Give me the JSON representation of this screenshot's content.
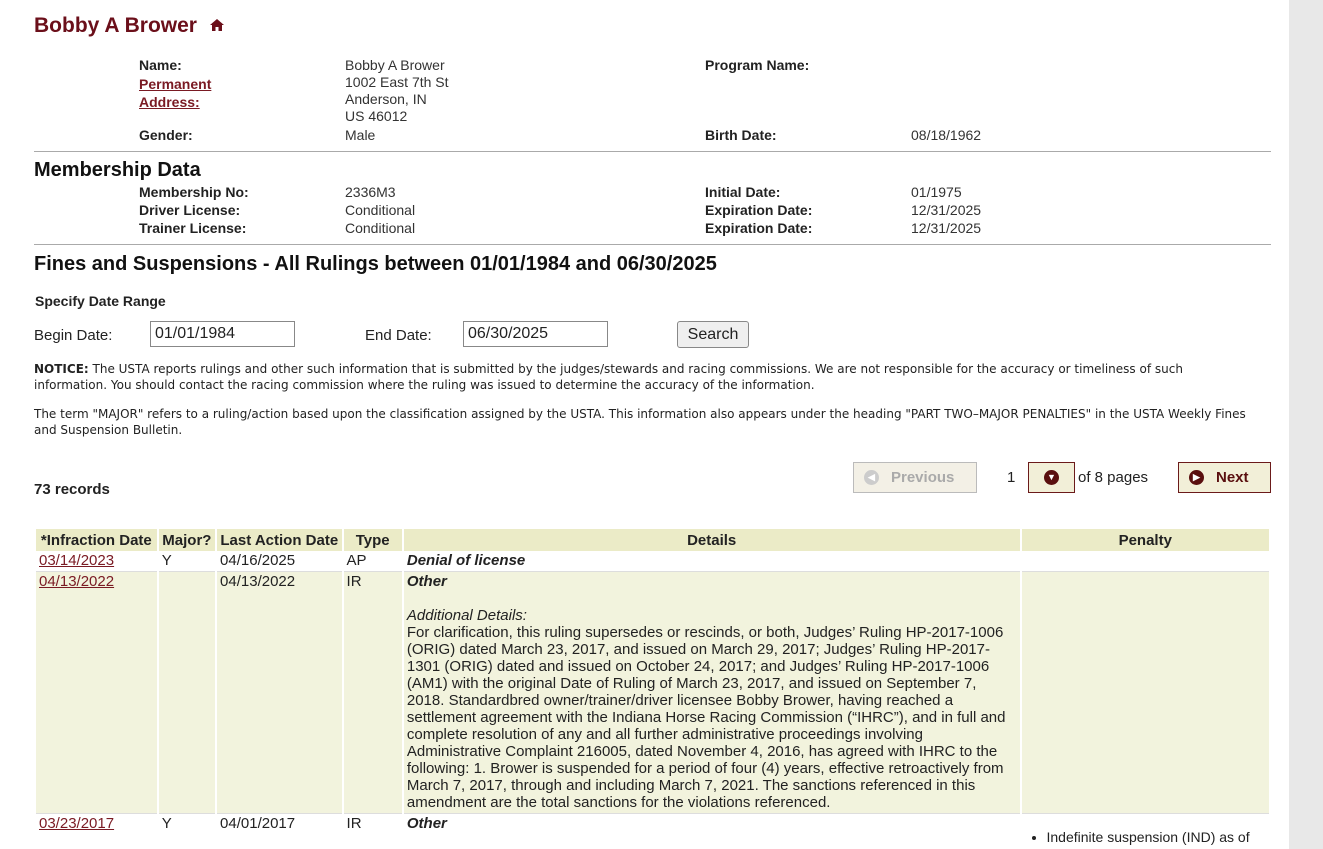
{
  "person": {
    "title": "Bobby A Brower",
    "name_label": "Name:",
    "name": "Bobby A Brower",
    "address_label_1": "Permanent",
    "address_label_2": "Address:",
    "address_line1": "1002 East 7th St",
    "address_line2": "Anderson, IN",
    "address_line3": "US 46012",
    "gender_label": "Gender:",
    "gender": "Male",
    "program_label": "Program Name:",
    "birth_label": "Birth Date:",
    "birth_date": "08/18/1962"
  },
  "membership": {
    "heading": "Membership Data",
    "no_label": "Membership No:",
    "no": "2336M3",
    "driver_label": "Driver License:",
    "driver": "Conditional",
    "trainer_label": "Trainer License:",
    "trainer": "Conditional",
    "initial_label": "Initial Date:",
    "initial": "01/1975",
    "exp_label": "Expiration Date:",
    "driver_exp": "12/31/2025",
    "trainer_exp": "12/31/2025"
  },
  "fines": {
    "heading": "Fines and Suspensions - All Rulings between 01/01/1984 and 06/30/2025",
    "range_label": "Specify Date Range",
    "begin_label": "Begin Date:",
    "begin_value": "01/01/1984",
    "end_label": "End Date:",
    "end_value": "06/30/2025",
    "search_label": "Search",
    "notice_bold": "NOTICE:",
    "notice_text": " The USTA reports rulings and other such information that is submitted by the judges/stewards and racing commissions. We are not responsible for the accuracy or timeliness of such information. You should contact the racing commission where the ruling was issued to determine the accuracy of the information.",
    "major_text": "The term \"MAJOR\" refers to a ruling/action based upon the classification assigned by the USTA. This information also appears under the heading \"PART TWO–MAJOR PENALTIES\" in the USTA Weekly Fines and Suspension Bulletin.",
    "records": "73 records"
  },
  "pagination": {
    "previous": "Previous",
    "current_page": "1",
    "of_pages": "of 8 pages",
    "next": "Next"
  },
  "table": {
    "headers": [
      "*Infraction Date",
      "Major?",
      "Last Action Date",
      "Type",
      "Details",
      "Penalty"
    ],
    "rows": [
      {
        "date": "03/14/2023",
        "major": "Y",
        "last": "04/16/2025",
        "type": "AP",
        "details": "Denial of license",
        "additional_label": "",
        "additional": "",
        "penalty": ""
      },
      {
        "date": "04/13/2022",
        "major": "",
        "last": "04/13/2022",
        "type": "IR",
        "details": "Other",
        "additional_label": "Additional Details:",
        "additional": "For clarification, this ruling supersedes or rescinds, or both, Judges’ Ruling HP-2017-1006 (ORIG) dated March 23, 2017, and issued on March 29, 2017; Judges’ Ruling HP-2017-1301 (ORIG) dated and issued on October 24, 2017; and Judges’ Ruling HP-2017-1006 (AM1) with the original Date of Ruling of March 23, 2017, and issued on September 7, 2018. Standardbred owner/trainer/driver licensee Bobby Brower, having reached a settlement agreement with the Indiana Horse Racing Commission (“IHRC”), and in full and complete resolution of any and all further administrative proceedings involving Administrative Complaint 216005, dated November 4, 2016, has agreed with IHRC to the following: 1. Brower is suspended for a period of four (4) years, effective retroactively from March 7, 2017, through and including March 7, 2021. The sanctions referenced in this amendment are the total sanctions for the violations referenced.",
        "penalty": ""
      },
      {
        "date": "03/23/2017",
        "major": "Y",
        "last": "04/01/2017",
        "type": "IR",
        "details": "Other",
        "additional_label": "",
        "additional": "",
        "penalty": "Indefinite suspension (IND) as of"
      }
    ]
  }
}
